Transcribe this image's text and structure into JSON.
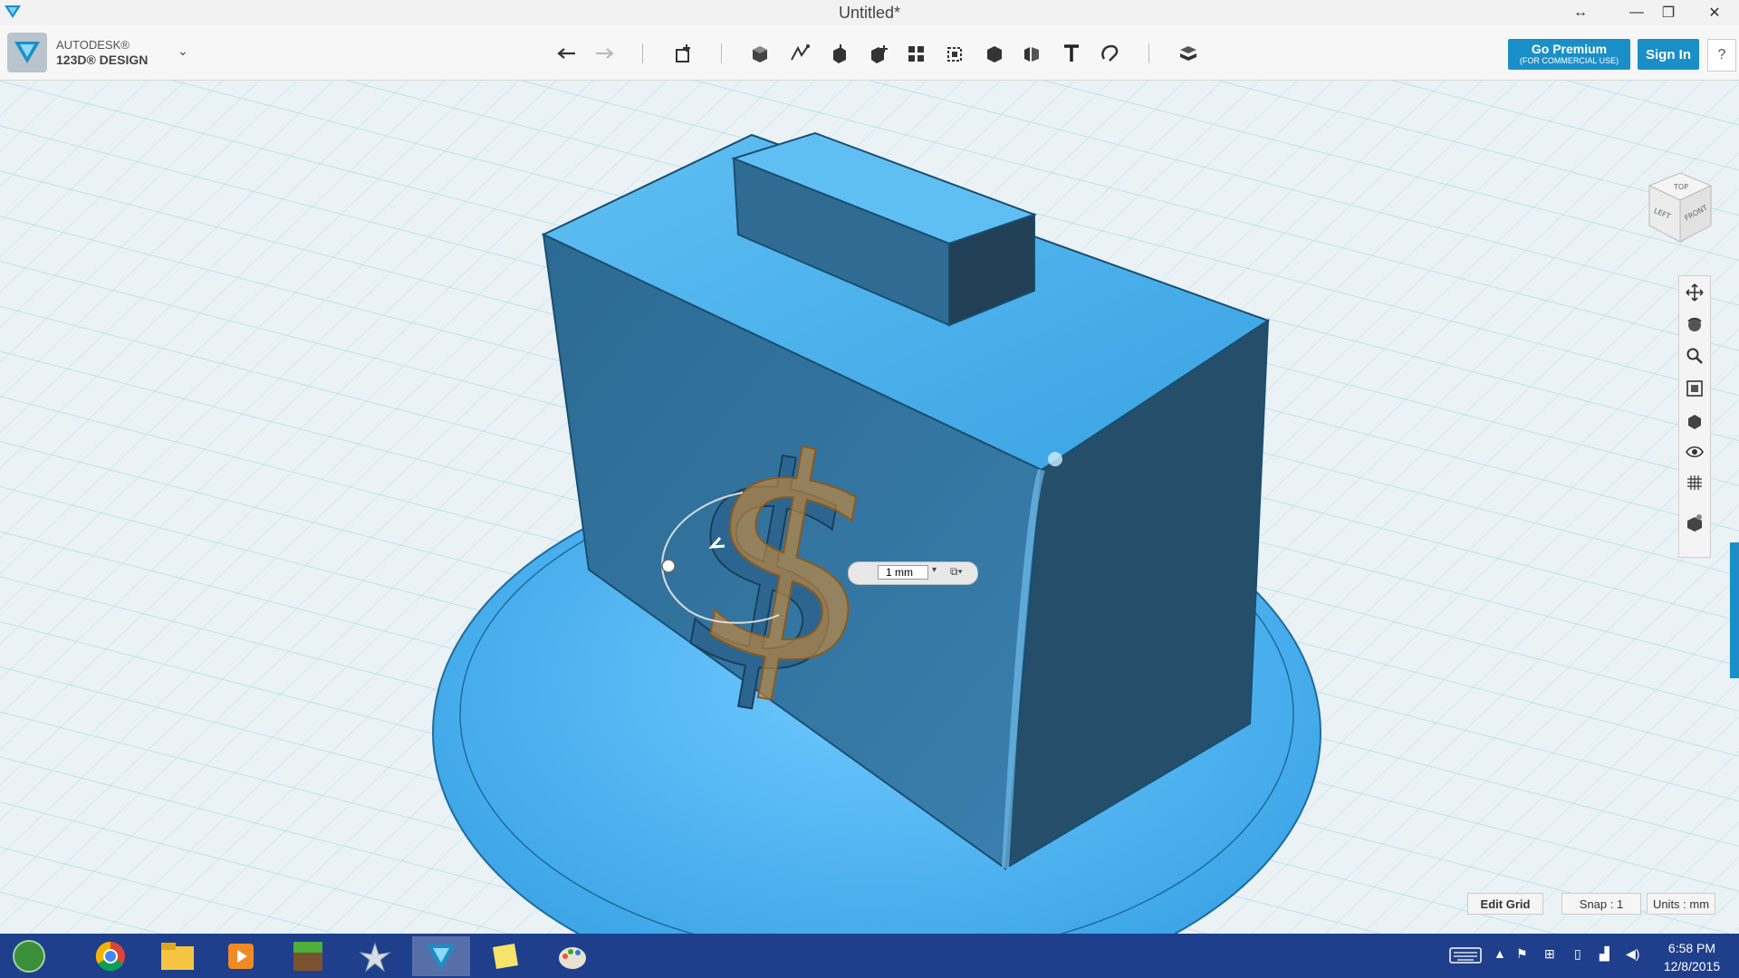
{
  "window": {
    "title": "Untitled*"
  },
  "brand": {
    "line1": "AUTODESK®",
    "line2": "123D® DESIGN"
  },
  "toolbar": {
    "tools": [
      "undo",
      "redo",
      "transform",
      "primitives",
      "sketch",
      "construct",
      "modify",
      "pattern",
      "grouping",
      "combine",
      "measure",
      "text",
      "snap",
      "material"
    ]
  },
  "account": {
    "premium_line1": "Go Premium",
    "premium_line2": "(FOR COMMERCIAL USE)",
    "signin": "Sign In",
    "help": "?"
  },
  "viewcube": {
    "top": "TOP",
    "left": "LEFT",
    "front": "FRONT"
  },
  "dimension": {
    "value": "1 mm"
  },
  "grid": {
    "edit": "Edit Grid",
    "snap": "Snap : 1",
    "units": "Units : mm"
  },
  "taskbar": {
    "time": "6:58 PM",
    "date": "12/8/2015"
  },
  "colors": {
    "accent": "#1a8fc7",
    "model": "#3fa6e6",
    "taskbar": "#1f3f8c"
  }
}
